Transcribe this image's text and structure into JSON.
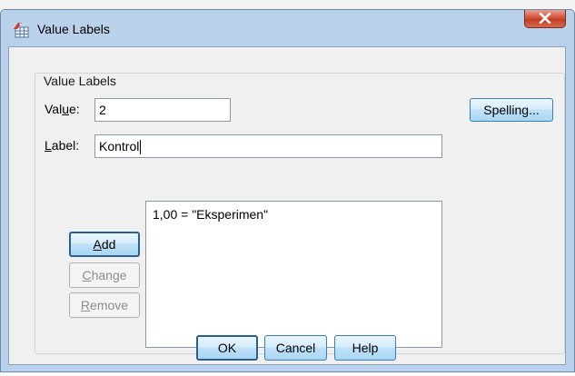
{
  "window": {
    "title": "Value Labels",
    "close_glyph": "X",
    "icon": "value-labels-app-icon"
  },
  "group": {
    "legend": "Value Labels"
  },
  "value_field": {
    "label_before": "Val",
    "label_mnemonic": "u",
    "label_after": "e:",
    "value": "2"
  },
  "label_field": {
    "label_mnemonic": "L",
    "label_after": "abel:",
    "value": "Kontrol"
  },
  "buttons": {
    "spelling": "Spelling...",
    "add": {
      "mnemonic": "A",
      "rest": "dd"
    },
    "change": {
      "mnemonic": "C",
      "rest": "hange"
    },
    "remove": {
      "mnemonic": "R",
      "rest": "emove"
    },
    "ok": "OK",
    "cancel": "Cancel",
    "help": "Help"
  },
  "list": {
    "items": [
      "1,00 = \"Eksperimen\""
    ]
  },
  "colors": {
    "frame": "#b9d1ea",
    "client": "#f0f0f0",
    "close": "#c23c22",
    "blue_button": "#bfe2f7"
  }
}
